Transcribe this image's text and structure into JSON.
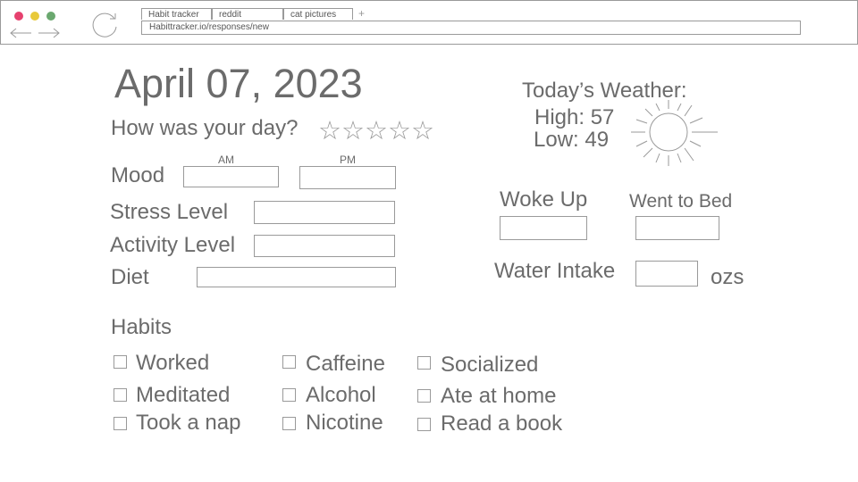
{
  "browser": {
    "tabs": [
      "Habit tracker",
      "reddit",
      "cat pictures"
    ],
    "new_tab": "+",
    "url": "Habittracker.io/responses/new"
  },
  "page": {
    "date": "April 07, 2023",
    "day_question": "How was your day?",
    "stars": "☆☆☆☆☆",
    "fields": {
      "mood": "Mood",
      "am": "AM",
      "pm": "PM",
      "stress": "Stress Level",
      "activity": "Activity Level",
      "diet": "Diet"
    },
    "weather": {
      "title": "Today’s Weather:",
      "high": "High: 57",
      "low": "Low: 49"
    },
    "sleep": {
      "woke_up": "Woke Up",
      "went_to_bed": "Went to Bed"
    },
    "water": {
      "label": "Water Intake",
      "unit": "ozs"
    },
    "habits": {
      "title": "Habits",
      "items": [
        "Worked",
        "Meditated",
        "Took a nap",
        "Caffeine",
        "Alcohol",
        "Nicotine",
        "Socialized",
        "Ate at home",
        "Read a book"
      ]
    }
  }
}
